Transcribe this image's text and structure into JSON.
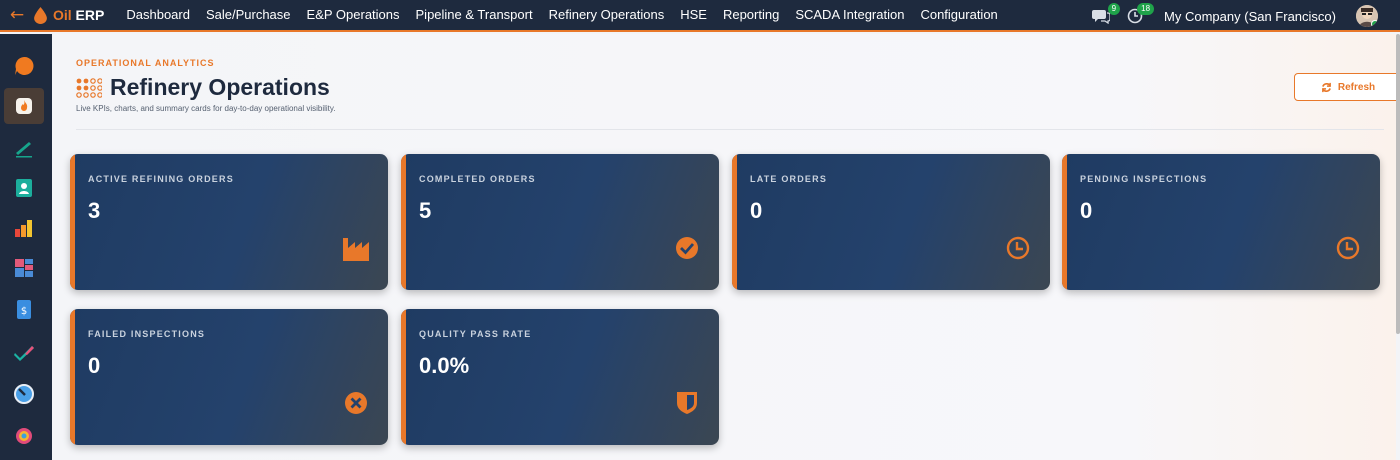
{
  "app": {
    "name_prefix": "Oil",
    "name_suffix": " ERP"
  },
  "nav": [
    "Dashboard",
    "Sale/Purchase",
    "E&P Operations",
    "Pipeline & Transport",
    "Refinery Operations",
    "HSE",
    "Reporting",
    "SCADA Integration",
    "Configuration"
  ],
  "toolbar": {
    "messages_count": "9",
    "activities_count": "18",
    "company": "My Company (San Francisco)"
  },
  "page": {
    "eyebrow": "OPERATIONAL ANALYTICS",
    "title": "Refinery Operations",
    "subtitle": "Live KPIs, charts, and summary cards for day-to-day operational visibility.",
    "refresh_label": "Refresh"
  },
  "kpis": [
    {
      "label": "ACTIVE REFINING ORDERS",
      "value": "3",
      "icon": "factory-icon"
    },
    {
      "label": "COMPLETED ORDERS",
      "value": "5",
      "icon": "check-circle-icon"
    },
    {
      "label": "LATE ORDERS",
      "value": "0",
      "icon": "clock-icon"
    },
    {
      "label": "PENDING INSPECTIONS",
      "value": "0",
      "icon": "clock-icon"
    },
    {
      "label": "FAILED INSPECTIONS",
      "value": "0",
      "icon": "x-circle-icon"
    },
    {
      "label": "QUALITY PASS RATE",
      "value": "0.0%",
      "icon": "shield-icon"
    }
  ],
  "colors": {
    "accent": "#e8782a",
    "navbar": "#1e2a3e",
    "card": "#1f3b62"
  }
}
